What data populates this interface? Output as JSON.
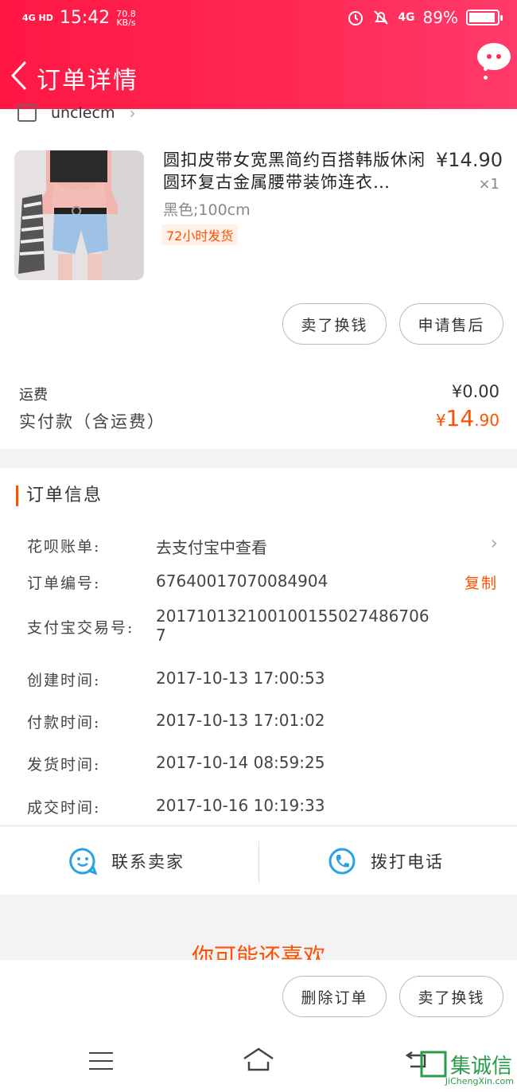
{
  "status_bar": {
    "network": "4G HD",
    "time": "15:42",
    "speed_value": "70.8",
    "speed_unit": "KB/s",
    "battery": "89%",
    "lte": "4G"
  },
  "nav": {
    "title": "订单详情"
  },
  "shop": {
    "name": "unclecm"
  },
  "product": {
    "title": "圆扣皮带女宽黑简约百搭韩版休闲圆环复古金属腰带装饰连衣…",
    "price": "¥14.90",
    "qty": "×1",
    "sku": "黑色;100cm",
    "tag": "72小时发货"
  },
  "actions": {
    "sell": "卖了换钱",
    "after_sale": "申请售后"
  },
  "summary": {
    "freight_label": "运费",
    "freight_value": "¥0.00",
    "paid_label": "实付款（含运费）",
    "paid_currency": "¥",
    "paid_int": "14",
    "paid_dec": ".90"
  },
  "order_info": {
    "title": "订单信息",
    "rows": [
      {
        "label": "花呗账单:",
        "value": "去支付宝中查看"
      },
      {
        "label": "订单编号:",
        "value": "67640017070084904",
        "action": "复制"
      },
      {
        "label": "支付宝交易号:",
        "value": "2017101321001001550274867067"
      },
      {
        "label": "创建时间:",
        "value": "2017-10-13 17:00:53"
      },
      {
        "label": "付款时间:",
        "value": "2017-10-13 17:01:02"
      },
      {
        "label": "发货时间:",
        "value": "2017-10-14 08:59:25"
      },
      {
        "label": "成交时间:",
        "value": "2017-10-16 10:19:33"
      }
    ]
  },
  "contact": {
    "seller": "联系卖家",
    "call": "拨打电话"
  },
  "recommend": {
    "title": "你可能还喜欢"
  },
  "bottom": {
    "delete": "删除订单",
    "sell": "卖了换钱"
  },
  "watermark": {
    "text": "集诚信",
    "url": "JiChengXin.com"
  },
  "colors": {
    "brand": "#ff2a55",
    "accent": "#ff5000",
    "link": "#27a2e2"
  }
}
